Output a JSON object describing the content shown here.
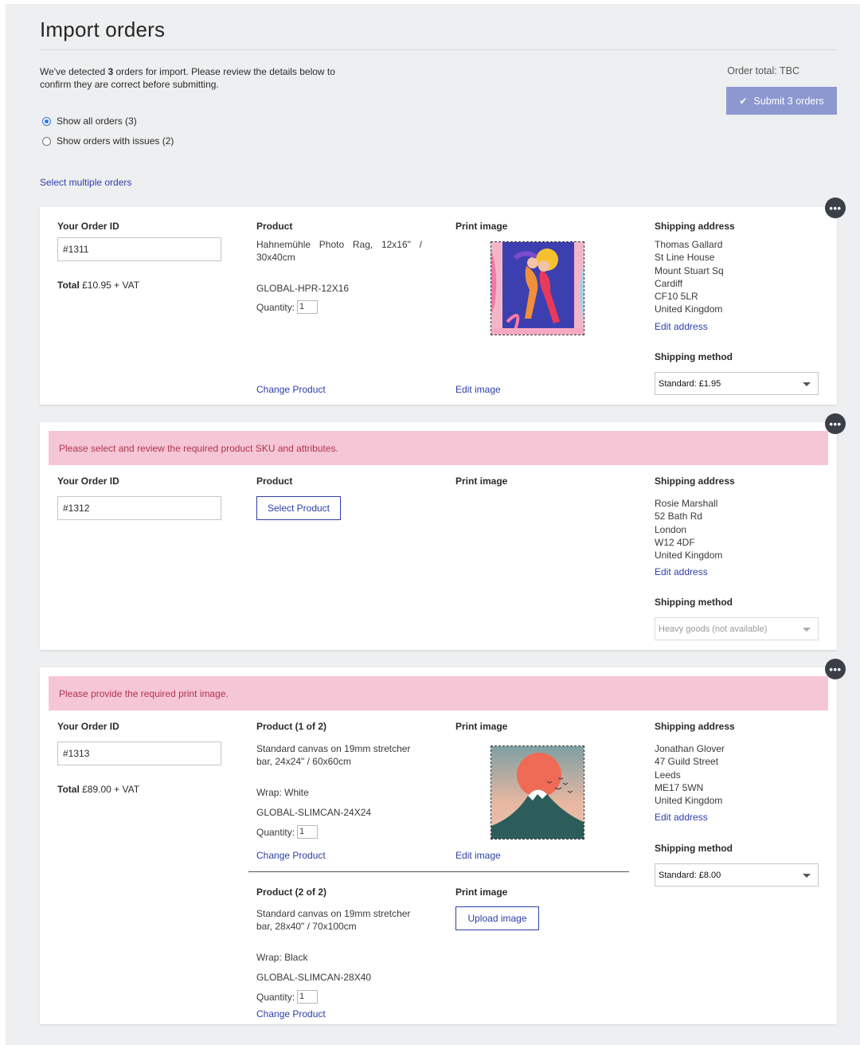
{
  "header": {
    "title": "Import orders",
    "intro_prefix": "We've detected ",
    "intro_count": "3",
    "intro_suffix": " orders for import. Please review the details below to confirm they are correct before submitting.",
    "order_total": "Order total: TBC",
    "submit_label": "Submit 3 orders"
  },
  "filters": {
    "show_all": "Show all orders (3)",
    "show_issues": "Show orders with issues (2)",
    "selected": "show_all"
  },
  "select_multiple": "Select multiple orders",
  "labels": {
    "order_id": "Your Order ID",
    "product": "Product",
    "print_image": "Print image",
    "shipping_address": "Shipping address",
    "shipping_method": "Shipping method",
    "quantity": "Quantity:",
    "change_product": "Change Product",
    "edit_image": "Edit image",
    "edit_address": "Edit address",
    "total_label": "Total",
    "vat": " + VAT",
    "more": "•••"
  },
  "orders": [
    {
      "order_id": "#1311",
      "total": "£10.95",
      "product": {
        "description": "Hahnemühle Photo Rag, 12x16\" / 30x40cm",
        "sku": "GLOBAL-HPR-12X16",
        "quantity": "1"
      },
      "address": [
        "Thomas Gallard",
        "St Line House",
        "Mount Stuart Sq",
        "Cardiff",
        "CF10 5LR",
        "United Kingdom"
      ],
      "shipping_method": "Standard: £1.95"
    },
    {
      "alert": "Please select and review the required product SKU and attributes.",
      "order_id": "#1312",
      "select_product": "Select Product",
      "address": [
        "Rosie Marshall",
        "52 Bath Rd",
        "London",
        "W12 4DF",
        "United Kingdom"
      ],
      "shipping_method": "Heavy goods (not available)"
    },
    {
      "alert": "Please provide the required print image.",
      "order_id": "#1313",
      "total": "£89.00",
      "products": [
        {
          "heading": "Product (1 of 2)",
          "description": "Standard canvas on 19mm stretcher bar, 24x24\" / 60x60cm",
          "wrap": "Wrap: White",
          "sku": "GLOBAL-SLIMCAN-24X24",
          "quantity": "1"
        },
        {
          "heading": "Product (2 of 2)",
          "description": "Standard canvas on 19mm stretcher bar, 28x40\" / 70x100cm",
          "wrap": "Wrap: Black",
          "sku": "GLOBAL-SLIMCAN-28X40",
          "quantity": "1",
          "upload_image": "Upload image"
        }
      ],
      "address": [
        "Jonathan Glover",
        "47 Guild Street",
        "Leeds",
        "ME17 5WN",
        "United Kingdom"
      ],
      "shipping_method": "Standard: £8.00"
    }
  ]
}
